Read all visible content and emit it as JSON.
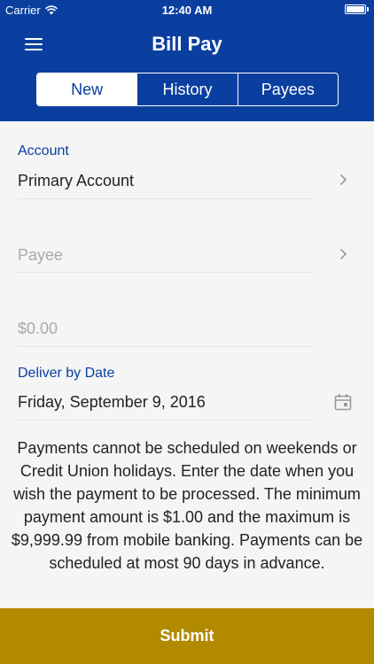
{
  "status_bar": {
    "carrier": "Carrier",
    "time": "12:40 AM"
  },
  "header": {
    "title": "Bill Pay",
    "tabs": [
      {
        "label": "New",
        "active": true
      },
      {
        "label": "History",
        "active": false
      },
      {
        "label": "Payees",
        "active": false
      }
    ]
  },
  "form": {
    "account_label": "Account",
    "account_value": "Primary Account",
    "payee_placeholder": "Payee",
    "amount_placeholder": "$0.00",
    "date_label": "Deliver by Date",
    "date_value": "Friday, September 9, 2016"
  },
  "info_text": "Payments cannot be scheduled on weekends or Credit Union holidays. Enter the date when you wish the payment to be processed. The minimum payment amount is $1.00 and the maximum is $9,999.99 from mobile banking. Payments can be scheduled at most 90 days in advance.",
  "submit_label": "Submit",
  "colors": {
    "brand": "#0a3fa0",
    "submit": "#b28a00",
    "label": "#0a3fa0",
    "placeholder": "#aaaaaa"
  },
  "icons": [
    "wifi-icon",
    "battery-icon",
    "menu-icon",
    "chevron-right-icon",
    "calendar-icon"
  ]
}
